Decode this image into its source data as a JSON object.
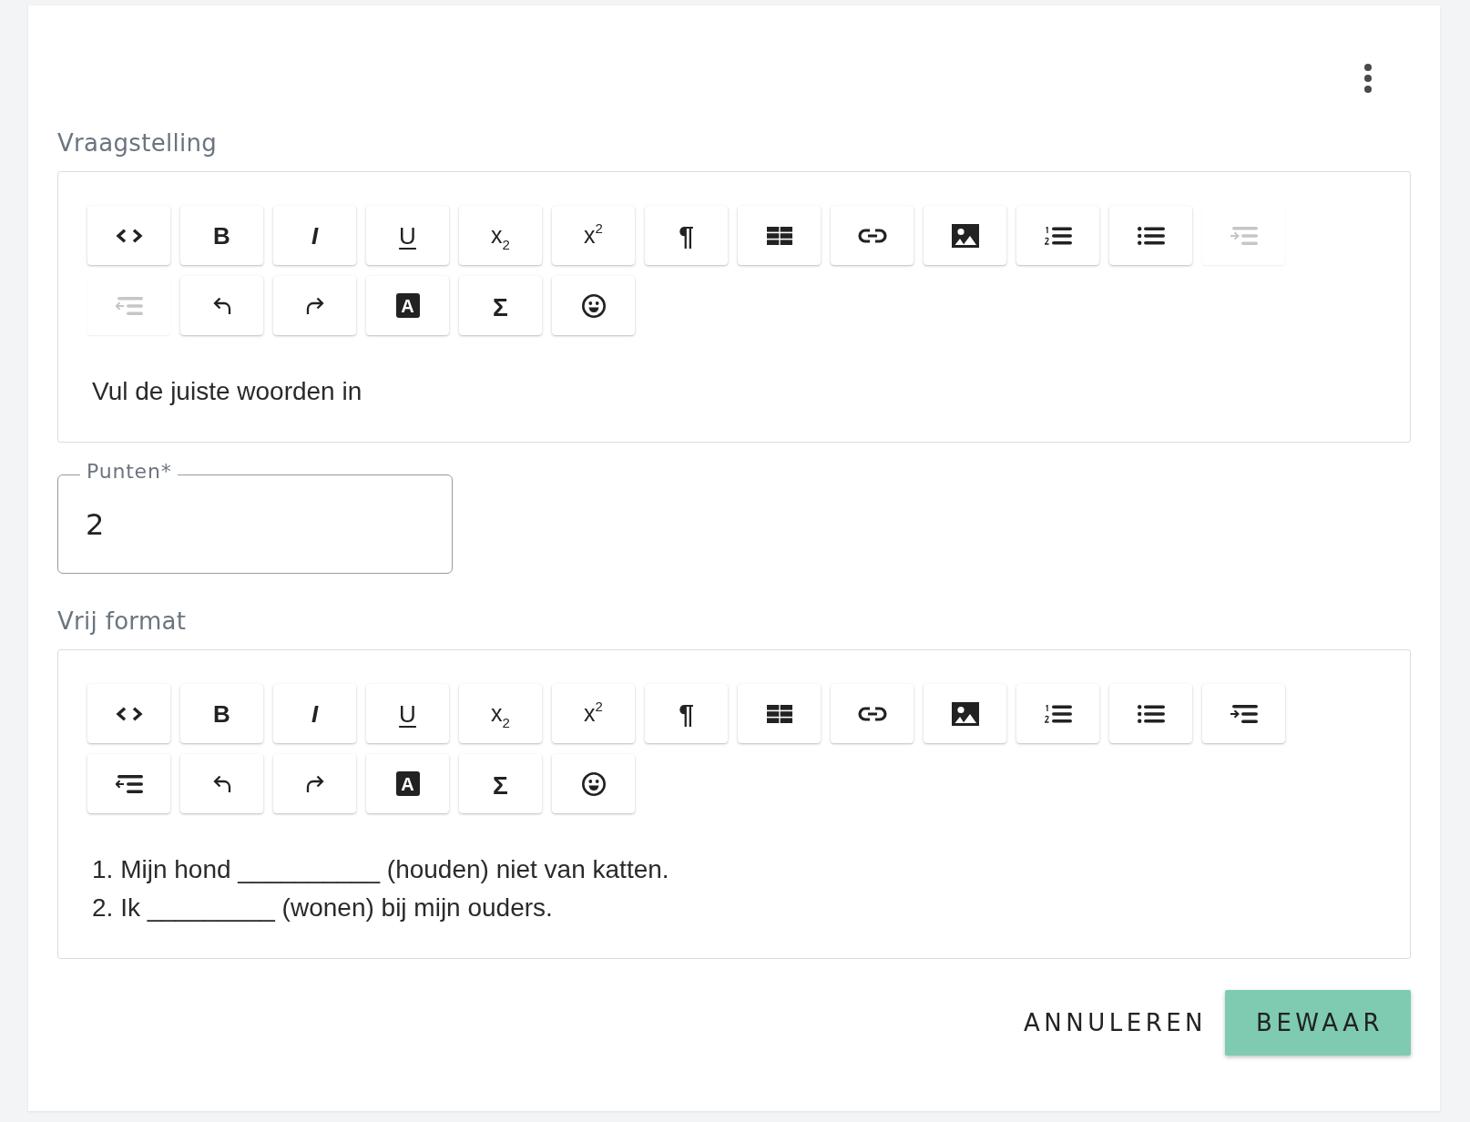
{
  "sections": [
    {
      "kind": "editor",
      "label": "Vraagstelling",
      "toolbar": [
        {
          "kind": "code",
          "disabled": false
        },
        {
          "kind": "bold",
          "label": "B",
          "disabled": false
        },
        {
          "kind": "italic",
          "label": "I",
          "disabled": false
        },
        {
          "kind": "underline",
          "label": "U",
          "disabled": false
        },
        {
          "kind": "subscript",
          "label": "x$_{2}$",
          "disabled": false
        },
        {
          "kind": "superscript",
          "label": "x$^{2}$",
          "disabled": false
        },
        {
          "kind": "paragraph",
          "label": "¶",
          "disabled": false
        },
        {
          "kind": "table",
          "disabled": false
        },
        {
          "kind": "link",
          "disabled": false
        },
        {
          "kind": "image",
          "disabled": false
        },
        {
          "kind": "numbered",
          "disabled": false
        },
        {
          "kind": "bulleted",
          "disabled": false
        },
        {
          "kind": "indent",
          "disabled": true
        },
        {
          "kind": "outdent",
          "disabled": true
        },
        {
          "kind": "undo",
          "disabled": false
        },
        {
          "kind": "redo",
          "disabled": false
        },
        {
          "kind": "color",
          "label": "A",
          "disabled": false
        },
        {
          "kind": "formula",
          "label": "Σ",
          "disabled": false
        },
        {
          "kind": "emoji",
          "disabled": false
        }
      ],
      "lines": [
        "Vul de juiste woorden in"
      ]
    },
    {
      "kind": "number_field",
      "label": "Punten*",
      "value": "2"
    },
    {
      "kind": "editor",
      "label": "Vrij format",
      "toolbar": [
        {
          "kind": "code",
          "disabled": false
        },
        {
          "kind": "bold",
          "label": "B",
          "disabled": false
        },
        {
          "kind": "italic",
          "label": "I",
          "disabled": false
        },
        {
          "kind": "underline",
          "label": "U",
          "disabled": false
        },
        {
          "kind": "subscript",
          "label": "x$_{2}$",
          "disabled": false
        },
        {
          "kind": "superscript",
          "label": "x$^{2}$",
          "disabled": false
        },
        {
          "kind": "paragraph",
          "label": "¶",
          "disabled": false
        },
        {
          "kind": "table",
          "disabled": false
        },
        {
          "kind": "link",
          "disabled": false
        },
        {
          "kind": "image",
          "disabled": false
        },
        {
          "kind": "numbered",
          "disabled": false
        },
        {
          "kind": "bulleted",
          "disabled": false
        },
        {
          "kind": "indent",
          "disabled": false
        },
        {
          "kind": "outdent",
          "disabled": false
        },
        {
          "kind": "undo",
          "disabled": false
        },
        {
          "kind": "redo",
          "disabled": false
        },
        {
          "kind": "color",
          "label": "A",
          "disabled": false
        },
        {
          "kind": "formula",
          "label": "Σ",
          "disabled": false
        },
        {
          "kind": "emoji",
          "disabled": false
        }
      ],
      "lines": [
        "1. Mijn hond __________ (houden) niet van katten.",
        "2. Ik _________ (wonen) bij mijn ouders."
      ]
    }
  ],
  "actions": [
    {
      "kind": "secondary",
      "label": "ANNULEREN"
    },
    {
      "kind": "primary",
      "label": "BEWAAR"
    }
  ]
}
